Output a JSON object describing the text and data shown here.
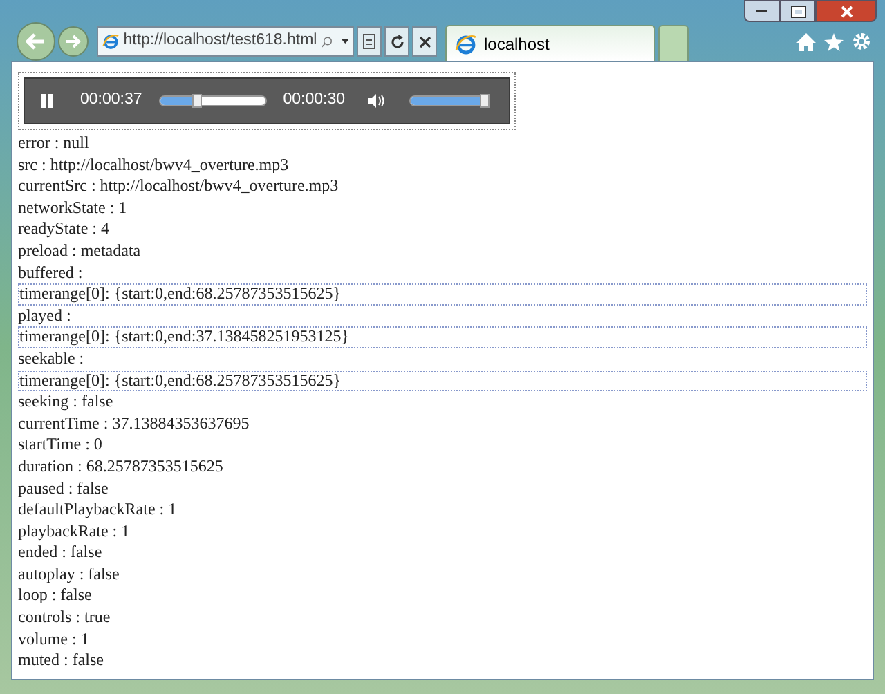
{
  "browser": {
    "address": "http://localhost/test618.html",
    "tabs": [
      {
        "label": "localhost",
        "selected": true
      },
      {
        "selected": false
      }
    ]
  },
  "player": {
    "playing": true,
    "elapsed": "00:00:37",
    "progress": {
      "level": 0.34
    },
    "remaining": "00:00:30",
    "muted": false,
    "volume": {
      "level": 0.95
    }
  },
  "lines": [
    {
      "kind": "line",
      "text": "error : null"
    },
    {
      "kind": "line",
      "text": "src : http://localhost/bwv4_overture.mp3"
    },
    {
      "kind": "line",
      "text": "currentSrc : http://localhost/bwv4_overture.mp3"
    },
    {
      "kind": "line",
      "text": "networkState : 1"
    },
    {
      "kind": "line",
      "text": "readyState : 4"
    },
    {
      "kind": "line",
      "text": "preload : metadata"
    },
    {
      "kind": "line",
      "text": "buffered :"
    },
    {
      "kind": "range",
      "text": "timerange[0]: {start:0,end:68.25787353515625}"
    },
    {
      "kind": "line",
      "text": "played :"
    },
    {
      "kind": "range",
      "text": "timerange[0]: {start:0,end:37.138458251953125}"
    },
    {
      "kind": "line",
      "text": "seekable :"
    },
    {
      "kind": "range",
      "text": "timerange[0]: {start:0,end:68.25787353515625}"
    },
    {
      "kind": "line",
      "text": "seeking : false"
    },
    {
      "kind": "line",
      "text": "currentTime : 37.13884353637695"
    },
    {
      "kind": "line",
      "text": "startTime : 0"
    },
    {
      "kind": "line",
      "text": "duration : 68.25787353515625"
    },
    {
      "kind": "line",
      "text": "paused : false"
    },
    {
      "kind": "line",
      "text": "defaultPlaybackRate : 1"
    },
    {
      "kind": "line",
      "text": "playbackRate : 1"
    },
    {
      "kind": "line",
      "text": "ended : false"
    },
    {
      "kind": "line",
      "text": "autoplay : false"
    },
    {
      "kind": "line",
      "text": "loop : false"
    },
    {
      "kind": "line",
      "text": "controls : true"
    },
    {
      "kind": "line",
      "text": "volume : 1"
    },
    {
      "kind": "line",
      "text": "muted : false"
    }
  ]
}
